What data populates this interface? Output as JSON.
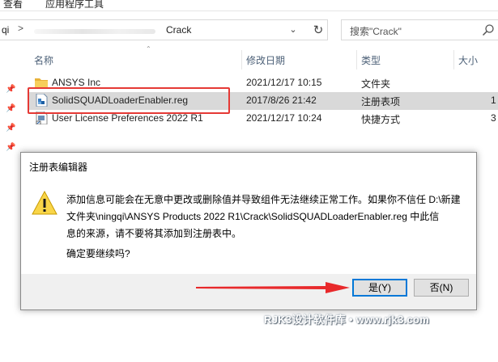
{
  "ribbon": {
    "tab_view": "查看",
    "tab_app_tools": "应用程序工具"
  },
  "address": {
    "prefix": "qi",
    "separator": ">",
    "current_folder": "Crack",
    "dropdown_glyph": "⌄",
    "refresh_glyph": "↻"
  },
  "search": {
    "placeholder": "搜索\"Crack\""
  },
  "columns": {
    "name": "名称",
    "modified": "修改日期",
    "type": "类型",
    "size": "大小"
  },
  "files": [
    {
      "name": "ANSYS Inc",
      "modified": "2021/12/17 10:15",
      "type": "文件夹",
      "size": "",
      "icon": "folder-icon"
    },
    {
      "name": "SolidSQUADLoaderEnabler.reg",
      "modified": "2017/8/26 21:42",
      "type": "注册表项",
      "size": "1",
      "icon": "registry-file-icon",
      "selected": true
    },
    {
      "name": "User License Preferences 2022 R1",
      "modified": "2021/12/17 10:24",
      "type": "快捷方式",
      "size": "3",
      "icon": "shortcut-icon"
    }
  ],
  "dialog": {
    "title": "注册表编辑器",
    "message_line1": "添加信息可能会在无意中更改或删除值并导致组件无法继续正常工作。如果你不信任 D:\\新建",
    "message_line2": "文件夹\\ningqi\\ANSYS Products 2022 R1\\Crack\\SolidSQUADLoaderEnabler.reg 中此信",
    "message_line3": "息的来源，请不要将其添加到注册表中。",
    "confirm": "确定要继续吗?",
    "yes_label": "是(Y)",
    "no_label": "否(N)"
  },
  "watermark": "RJK3设计软件库 • www.rjk3.com",
  "colors": {
    "highlight_red": "#e53935",
    "arrow_red": "#e8292b",
    "selection": "#d9d9d9",
    "accent": "#0078d7"
  }
}
